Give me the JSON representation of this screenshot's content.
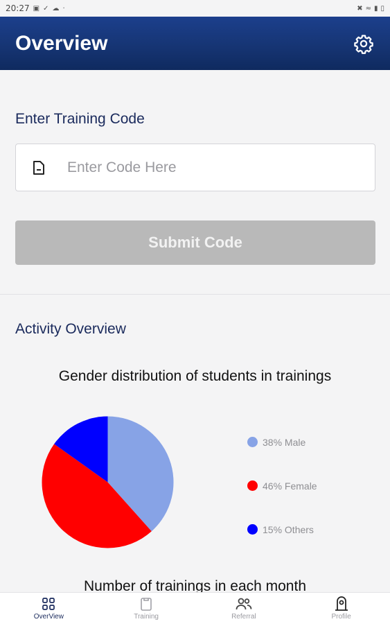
{
  "status_bar": {
    "time": "20:27"
  },
  "app_bar": {
    "title": "Overview",
    "settings_icon": "gear-icon"
  },
  "training_code": {
    "label": "Enter Training Code",
    "input_placeholder": "Enter Code Here",
    "input_value": "",
    "submit_label": "Submit Code"
  },
  "activity": {
    "label": "Activity Overview"
  },
  "chart_data": [
    {
      "type": "pie",
      "title": "Gender distribution of students in trainings",
      "slices": [
        {
          "label": "Male",
          "value": 38,
          "legend": "38% Male",
          "color": "#87a3e6"
        },
        {
          "label": "Female",
          "value": 46,
          "legend": "46% Female",
          "color": "#ff0000"
        },
        {
          "label": "Others",
          "value": 15,
          "legend": "15% Others",
          "color": "#0000ff"
        }
      ]
    }
  ],
  "next_chart_title": "Number of trainings in each month",
  "bottom_nav": {
    "items": [
      {
        "label": "OverView",
        "icon": "grid-icon",
        "active": true
      },
      {
        "label": "Training",
        "icon": "clipboard-icon",
        "active": false
      },
      {
        "label": "Referral",
        "icon": "people-icon",
        "active": false
      },
      {
        "label": "Profile",
        "icon": "profile-icon",
        "active": false
      }
    ]
  },
  "colors": {
    "app_bar": "#163574",
    "heading": "#1a2a5c",
    "button_disabled": "#b9b9b9"
  }
}
